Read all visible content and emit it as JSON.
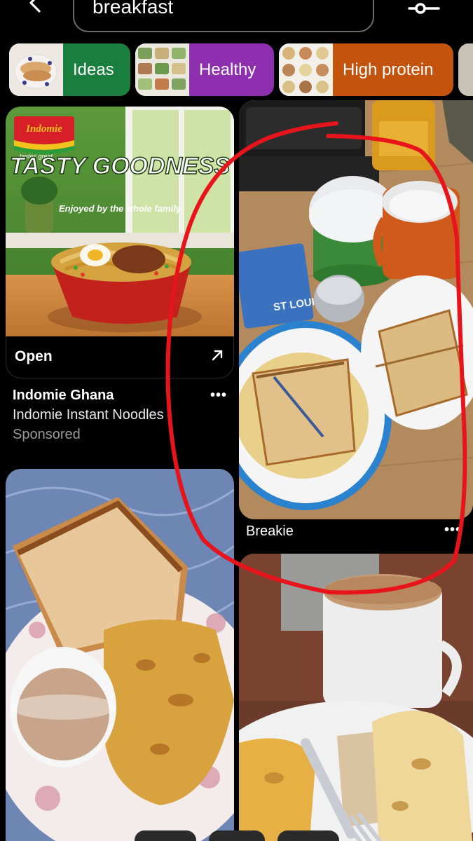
{
  "search": {
    "query": "breakfast"
  },
  "chips": [
    {
      "label": "Ideas",
      "color": "#1a7f3e"
    },
    {
      "label": "Healthy",
      "color": "#8e2fb0"
    },
    {
      "label": "High protein",
      "color": "#c4530e"
    }
  ],
  "ad": {
    "brand_logo_text": "Indomie",
    "brand_tagline": "tastes great",
    "headline": "TASTY GOODNESS",
    "subheadline": "Enjoyed by the whole family",
    "open_label": "Open",
    "name": "Indomie Ghana",
    "description": "Indomie Instant Noodles",
    "sponsored_label": "Sponsored"
  },
  "pins": [
    {
      "title": "Breakie",
      "product_text": "ST LOUIS"
    }
  ],
  "colors": {
    "background": "#000000",
    "annotation_circle": "#e8141c",
    "secondary_text": "#9a9a9a"
  }
}
